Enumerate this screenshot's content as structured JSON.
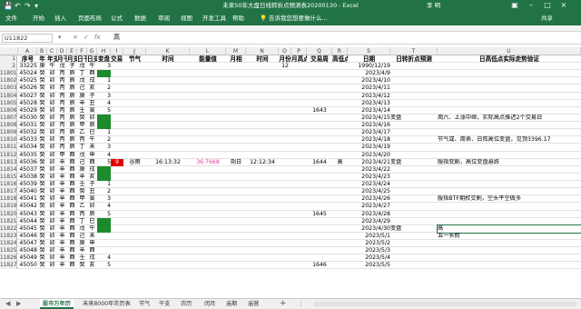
{
  "window": {
    "title": "未来50年大盘日线转折点预测表20200130 - Excel",
    "user": "李 明"
  },
  "ribbon": {
    "tabs": [
      "文件",
      "开始",
      "插入",
      "页面布局",
      "公式",
      "数据",
      "审阅",
      "视图",
      "开发工具",
      "帮助"
    ],
    "tell_me": "告诉我您想要做什么...",
    "share": "共享"
  },
  "formula_bar": {
    "name_box": "U11822",
    "cancel": "×",
    "enter": "✓",
    "fx": "fx",
    "content": "高"
  },
  "column_letters": [
    "A",
    "B",
    "C",
    "D",
    "E",
    "F",
    "G",
    "H",
    "I",
    "J",
    "K",
    "L",
    "M",
    "N",
    "O",
    "P",
    "Q",
    "R",
    "S",
    "T",
    "U"
  ],
  "headers": [
    "序号",
    "年",
    "年支",
    "月干",
    "月支",
    "日干",
    "日支",
    "变盘",
    "交易日",
    "节气",
    "时间",
    "能量值",
    "月相",
    "时间",
    "月份",
    "月高点",
    "交易周",
    "高低点",
    "日期",
    "日转折点预测",
    "日高低点实际走势验证"
  ],
  "rows": [
    {
      "n": "2",
      "seq": "33225",
      "y": "庚",
      "c": "午",
      "d": "戊",
      "e": "子",
      "f": "戊",
      "g": "午",
      "h": "3",
      "h_green": false,
      "o": "12",
      "s": "1990/12/19",
      "t": "",
      "u": ""
    },
    {
      "n": "11801",
      "seq": "45024",
      "y": "癸",
      "c": "卯",
      "d": "丙",
      "e": "辰",
      "f": "丁",
      "g": "酉",
      "h": "",
      "h_green": true,
      "s": "2023/4/9"
    },
    {
      "n": "11802",
      "seq": "45025",
      "y": "癸",
      "c": "卯",
      "d": "丙",
      "e": "辰",
      "f": "戊",
      "g": "戌",
      "h": "1",
      "h_green": false,
      "s": "2023/4/10"
    },
    {
      "n": "11803",
      "seq": "45026",
      "y": "癸",
      "c": "卯",
      "d": "丙",
      "e": "辰",
      "f": "己",
      "g": "亥",
      "h": "2",
      "h_green": false,
      "s": "2023/4/11"
    },
    {
      "n": "11804",
      "seq": "45027",
      "y": "癸",
      "c": "卯",
      "d": "丙",
      "e": "辰",
      "f": "庚",
      "g": "子",
      "h": "3",
      "h_green": false,
      "s": "2023/4/12"
    },
    {
      "n": "11805",
      "seq": "45028",
      "y": "癸",
      "c": "卯",
      "d": "丙",
      "e": "辰",
      "f": "辛",
      "g": "丑",
      "h": "4",
      "h_green": false,
      "s": "2023/4/13"
    },
    {
      "n": "11806",
      "seq": "45029",
      "y": "癸",
      "c": "卯",
      "d": "丙",
      "e": "辰",
      "f": "壬",
      "g": "寅",
      "h": "5",
      "h_green": false,
      "q": "1643",
      "s": "2023/4/14"
    },
    {
      "n": "11807",
      "seq": "45030",
      "y": "癸",
      "c": "卯",
      "d": "丙",
      "e": "辰",
      "f": "癸",
      "g": "卯",
      "h": "",
      "h_green": true,
      "s": "2023/4/15",
      "t": "变盘",
      "u": "周六、上涨中继，实际高点推迟2个交易日"
    },
    {
      "n": "11808",
      "seq": "45031",
      "y": "癸",
      "c": "卯",
      "d": "丙",
      "e": "辰",
      "f": "甲",
      "g": "辰",
      "h": "",
      "h_green": true,
      "s": "2023/4/16"
    },
    {
      "n": "11809",
      "seq": "45032",
      "y": "癸",
      "c": "卯",
      "d": "丙",
      "e": "辰",
      "f": "乙",
      "g": "巳",
      "h": "1",
      "h_green": false,
      "s": "2023/4/17"
    },
    {
      "n": "11810",
      "seq": "45033",
      "y": "癸",
      "c": "卯",
      "d": "丙",
      "e": "辰",
      "f": "丙",
      "g": "午",
      "h": "2",
      "h_green": false,
      "s": "2023/4/18",
      "u": "节气或、周表、日阵高位变盘，见顶3396.17"
    },
    {
      "n": "11811",
      "seq": "45034",
      "y": "癸",
      "c": "卯",
      "d": "丙",
      "e": "辰",
      "f": "丁",
      "g": "未",
      "h": "3",
      "h_green": false,
      "s": "2023/4/19"
    },
    {
      "n": "11812",
      "seq": "45035",
      "y": "癸",
      "c": "卯",
      "d": "甲",
      "e": "酉",
      "f": "戊",
      "g": "申",
      "h": "4",
      "h_green": false,
      "s": "2023/4/20"
    },
    {
      "n": "11813",
      "seq": "45036",
      "y": "癸",
      "c": "卯",
      "d": "辛",
      "e": "酉",
      "f": "己",
      "g": "酉",
      "h": "5",
      "h_green": false,
      "red": "9",
      "j": "谷雨",
      "k": "16:13:32",
      "l": "36.7668",
      "m": "朔日",
      "nn": "12:12:34",
      "q": "1644",
      "r": "高",
      "s": "2023/4/21",
      "t": "变盘",
      "u": "殷指变剧，高位变盘悬跌"
    },
    {
      "n": "11814",
      "seq": "45037",
      "y": "癸",
      "c": "卯",
      "d": "辛",
      "e": "酉",
      "f": "庚",
      "g": "戌",
      "h": "",
      "h_green": true,
      "s": "2023/4/22"
    },
    {
      "n": "11815",
      "seq": "45038",
      "y": "癸",
      "c": "卯",
      "d": "辛",
      "e": "酉",
      "f": "辛",
      "g": "亥",
      "h": "",
      "h_green": true,
      "s": "2023/4/23"
    },
    {
      "n": "11816",
      "seq": "45039",
      "y": "癸",
      "c": "卯",
      "d": "辛",
      "e": "酉",
      "f": "壬",
      "g": "子",
      "h": "1",
      "h_green": false,
      "s": "2023/4/24"
    },
    {
      "n": "11817",
      "seq": "45040",
      "y": "癸",
      "c": "卯",
      "d": "辛",
      "e": "酉",
      "f": "癸",
      "g": "丑",
      "h": "2",
      "h_green": false,
      "s": "2023/4/25"
    },
    {
      "n": "11818",
      "seq": "45041",
      "y": "癸",
      "c": "卯",
      "d": "辛",
      "e": "酉",
      "f": "甲",
      "g": "寅",
      "h": "3",
      "h_green": false,
      "s": "2023/4/26",
      "u": "殷指BTF期权交割，空头平空做多"
    },
    {
      "n": "11819",
      "seq": "45042",
      "y": "癸",
      "c": "卯",
      "d": "辛",
      "e": "酉",
      "f": "乙",
      "g": "卯",
      "h": "4",
      "h_green": false,
      "s": "2023/4/27"
    },
    {
      "n": "11820",
      "seq": "45043",
      "y": "癸",
      "c": "卯",
      "d": "辛",
      "e": "酉",
      "f": "丙",
      "g": "辰",
      "h": "5",
      "h_green": false,
      "q": "1645",
      "s": "2023/4/28"
    },
    {
      "n": "11821",
      "seq": "45044",
      "y": "癸",
      "c": "卯",
      "d": "辛",
      "e": "酉",
      "f": "丁",
      "g": "巳",
      "h": "",
      "h_green": true,
      "s": "2023/4/29"
    },
    {
      "n": "11822",
      "seq": "45045",
      "y": "癸",
      "c": "卯",
      "d": "辛",
      "e": "酉",
      "f": "戊",
      "g": "午",
      "h": "",
      "h_green": true,
      "s": "2023/4/30",
      "t": "变盘",
      "u": "高",
      "sel": true
    },
    {
      "n": "11823",
      "seq": "45046",
      "y": "癸",
      "c": "卯",
      "d": "辛",
      "e": "酉",
      "f": "己",
      "g": "未",
      "h": "",
      "h_green": false,
      "s": "2023/5/1",
      "u": "五一长假"
    },
    {
      "n": "11824",
      "seq": "45047",
      "y": "癸",
      "c": "卯",
      "d": "辛",
      "e": "酉",
      "f": "庚",
      "g": "申",
      "h": "",
      "h_green": false,
      "s": "2023/5/2"
    },
    {
      "n": "11825",
      "seq": "45048",
      "y": "癸",
      "c": "卯",
      "d": "辛",
      "e": "酉",
      "f": "辛",
      "g": "酉",
      "h": "",
      "h_green": false,
      "s": "2023/5/3"
    },
    {
      "n": "11826",
      "seq": "45049",
      "y": "癸",
      "c": "卯",
      "d": "辛",
      "e": "酉",
      "f": "壬",
      "g": "戌",
      "h": "4",
      "h_green": false,
      "s": "2023/5/4"
    },
    {
      "n": "11827",
      "seq": "45050",
      "y": "癸",
      "c": "卯",
      "d": "辛",
      "e": "酉",
      "f": "癸",
      "g": "亥",
      "h": "5",
      "h_green": false,
      "q": "1646",
      "s": "2023/5/5"
    }
  ],
  "sheet_tabs": [
    "股市万年历",
    "未来8000年农历表",
    "节气",
    "干支",
    "农历",
    "闰月",
    "庙期",
    "庙营"
  ],
  "sheet_add": "+",
  "colors": {
    "excel_green": "#217346",
    "cell_green": "#1e8a2e",
    "cell_red": "#e00000"
  }
}
